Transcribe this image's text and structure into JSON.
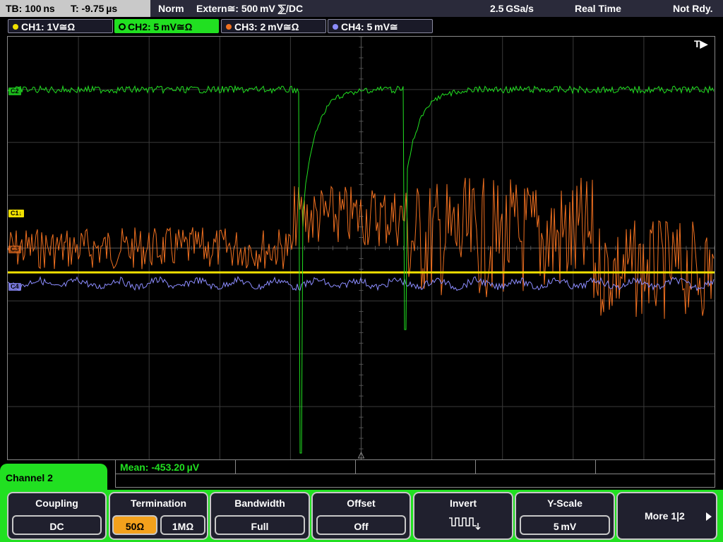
{
  "status_bar": {
    "timebase": "TB: 100 ns",
    "trigger_time": "T: -9.75 µs",
    "mode": "Norm",
    "trigger_source": "Extern≅: 500 mV ⅀/DC",
    "sample_rate": "2.5 GSa/s",
    "acq_mode": "Real Time",
    "status": "Not Rdy."
  },
  "channels": [
    {
      "label": "CH1: 1V≅Ω",
      "color": "#f0e000"
    },
    {
      "label": "CH2: 5 mV≅Ω",
      "color": "#21e021"
    },
    {
      "label": "CH3: 2 mV≅Ω",
      "color": "#f07020"
    },
    {
      "label": "CH4: 5 mV≅",
      "color": "#8c8cff"
    }
  ],
  "waveform_markers": {
    "trigger": "T▶",
    "ch1": "C1↓",
    "ch3": "C3",
    "ch4": "C4",
    "ch2": "C2"
  },
  "measurement": {
    "mean": "Mean: -453.20 µV"
  },
  "menu": {
    "title": "Channel 2",
    "coupling": {
      "title": "Coupling",
      "value": "DC"
    },
    "termination": {
      "title": "Termination",
      "option_50": "50Ω",
      "option_1m": "1MΩ"
    },
    "bandwidth": {
      "title": "Bandwidth",
      "value": "Full"
    },
    "offset": {
      "title": "Offset",
      "value": "Off"
    },
    "invert": {
      "title": "Invert"
    },
    "yscale": {
      "title": "Y-Scale",
      "value": "5 mV"
    },
    "more": {
      "label": "More 1|2"
    }
  }
}
